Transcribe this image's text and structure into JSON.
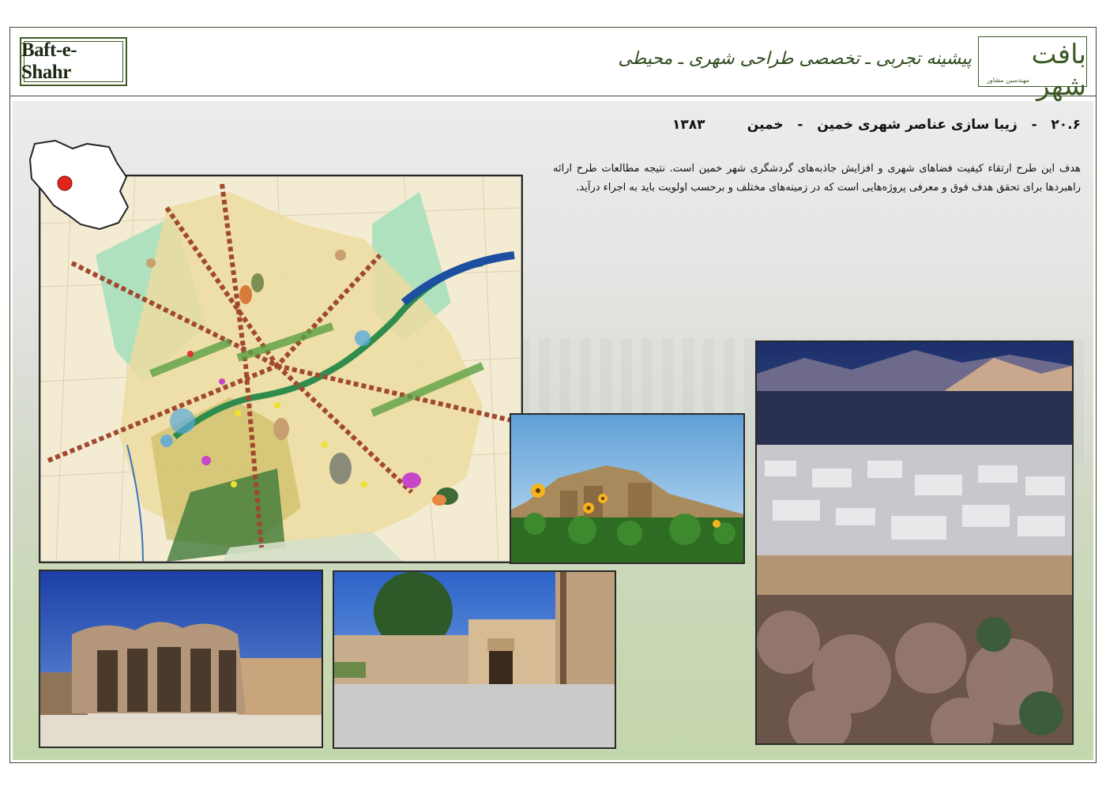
{
  "header": {
    "logo_text": "Baft-e-Shahr",
    "title": "پیشینه تجربی ـ تخصصی طراحی شهری ـ محیطی",
    "brand_word": "بافت شهر",
    "brand_sub": "مهندسین مشاور"
  },
  "section": {
    "number": "۲۰.۶",
    "dash1": "-",
    "name": "زیبا سازی عناصر شهری خمین",
    "dash2": "-",
    "city": "خمین",
    "year": "۱۳۸۳"
  },
  "description": "هدف این طرح ارتقاء کیفیت فضاهای شهری و افزایش جاذبه‌های گردشگری شهر خمین است. نتیجه مطالعات طرح ارائه راهبردها برای تحقق هدف فوق و معرفی پروژه‌هایی است که در زمینه‌های مختلف و برحسب اولویت باید به اجراء درآید.",
  "colors": {
    "frame": "#3c4a2c",
    "accent_green": "#3d5a26",
    "location_marker": "#e0251b"
  },
  "icons": {
    "location_marker": "red-dot-icon"
  }
}
